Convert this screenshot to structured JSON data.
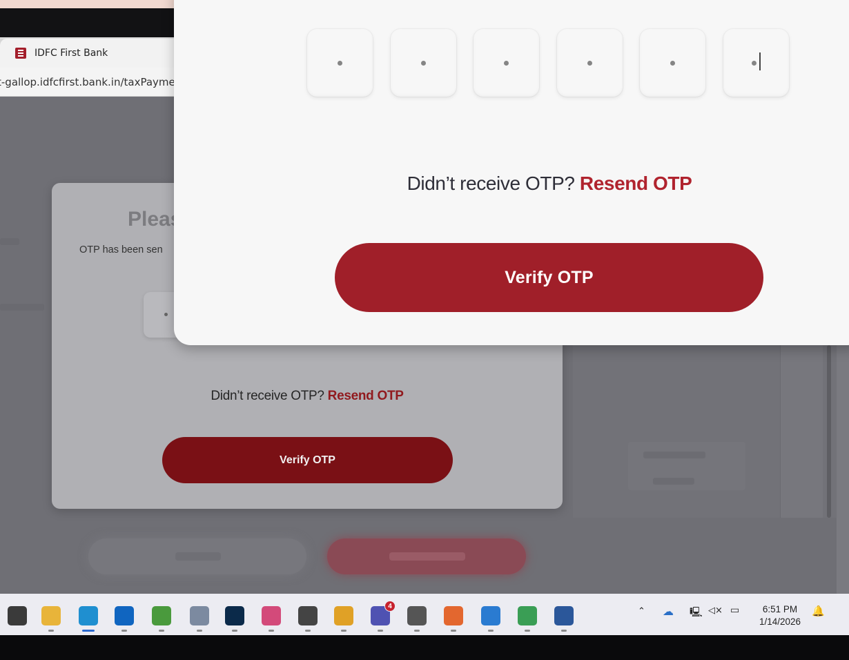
{
  "browser": {
    "tab_title": "IDFC First Bank",
    "url": "t-gallop.idfcfirst.bank.in/taxPayme"
  },
  "bg_modal": {
    "title": "Pleas",
    "subtitle": "OTP has been sen",
    "resend_prefix": "Didn’t receive OTP?",
    "resend_link": "Resend OTP",
    "verify_label": "Verify OTP"
  },
  "fg_modal": {
    "otp_digits": [
      "•",
      "•",
      "•",
      "•",
      "•",
      "•"
    ],
    "resend_prefix": "Didn’t receive OTP?",
    "resend_link": "Resend OTP",
    "verify_label": "Verify OTP"
  },
  "taskbar": {
    "apps": [
      {
        "name": "task-view-icon",
        "color": "#3a3a3a"
      },
      {
        "name": "file-explorer-icon",
        "color": "#e8b43a"
      },
      {
        "name": "edge-icon",
        "color": "#1f8fd0"
      },
      {
        "name": "outlook-icon",
        "color": "#1065c0"
      },
      {
        "name": "paint-icon",
        "color": "#4a9a3d"
      },
      {
        "name": "app-installer-icon",
        "color": "#7c8aa0"
      },
      {
        "name": "webex-icon",
        "color": "#0b2a4a"
      },
      {
        "name": "m365-icon",
        "color": "#d34a7a"
      },
      {
        "name": "clock-app-icon",
        "color": "#444"
      },
      {
        "name": "chrome-icon",
        "color": "#e0a126"
      },
      {
        "name": "teams-icon",
        "color": "#4f52b2"
      },
      {
        "name": "settings-icon",
        "color": "#555"
      },
      {
        "name": "pen-app-icon",
        "color": "#e3672f"
      },
      {
        "name": "notepad-icon",
        "color": "#2a7bd1"
      },
      {
        "name": "media-player-icon",
        "color": "#3a9e55"
      },
      {
        "name": "word-icon",
        "color": "#2b579a"
      }
    ],
    "teams_badge": "4",
    "time": "6:51 PM",
    "date": "1/14/2026"
  },
  "colors": {
    "brand_red": "#a01f29",
    "resend_red": "#b0232e"
  }
}
